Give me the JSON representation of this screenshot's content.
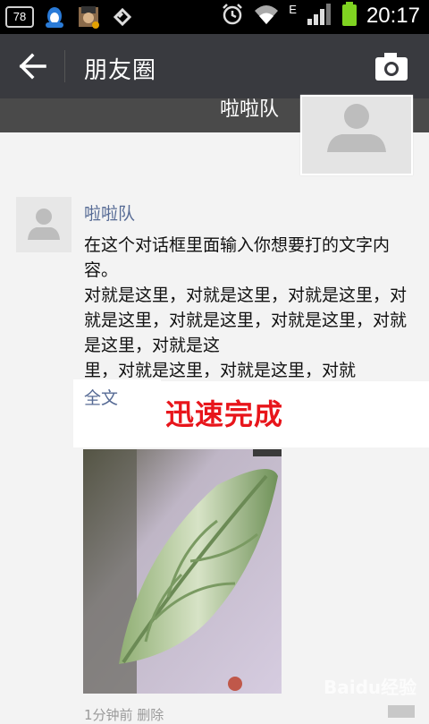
{
  "status_bar": {
    "battery_level": "78",
    "network_type": "E",
    "time": "20:17",
    "icons": [
      "battery-level-icon",
      "qq-notification-icon",
      "avatar-notification-icon",
      "usb-icon",
      "alarm-icon",
      "wifi-icon",
      "signal-icon",
      "battery-icon"
    ]
  },
  "header": {
    "title": "朋友圈",
    "icons": [
      "back-arrow-icon",
      "camera-icon"
    ]
  },
  "cover": {
    "user_name": "啦啦队"
  },
  "post": {
    "author": "啦啦队",
    "text": "在这个对话框里面输入你想要打的文字内容。\n对就是这里，对就是这里，对就是这里，对就是这里，对就是这里，对就是这里，对就是这里，对就是这\n里，对就是这里，对就是这里，对就",
    "full_text_link": "全文",
    "overlay_caption": "迅速完成",
    "meta_partial": "1分钟前  删除"
  },
  "watermark": "Baidu经验",
  "colors": {
    "link": "#576b95",
    "titlebar": "#393a3f",
    "overlay_caption": "#e8151b"
  }
}
